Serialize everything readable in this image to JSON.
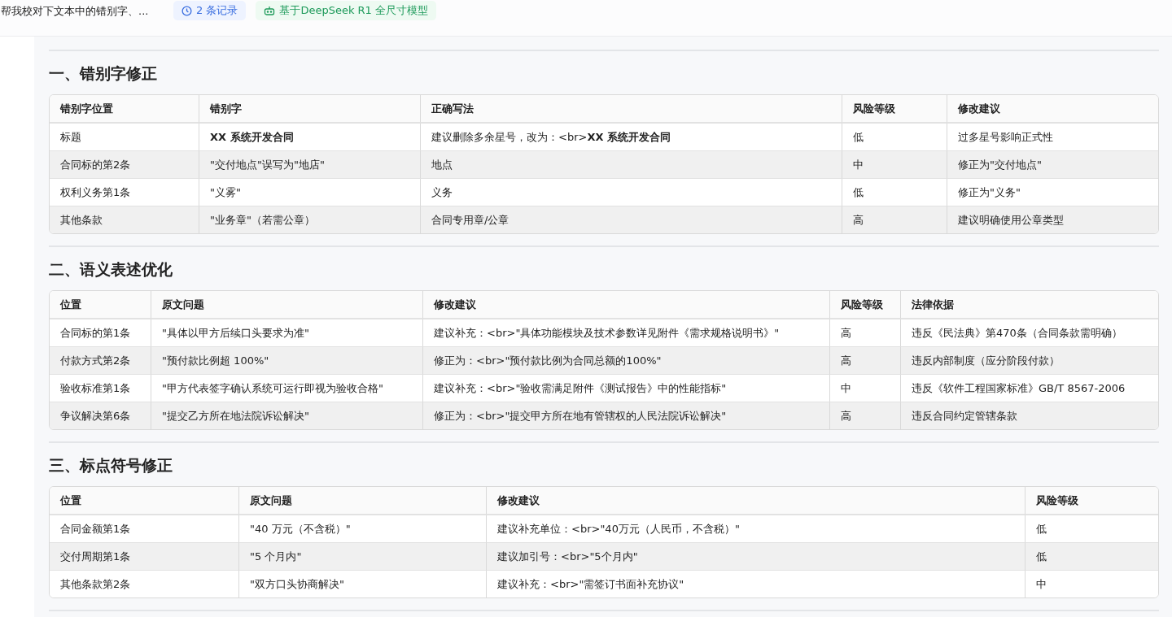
{
  "header": {
    "title": "帮我校对下文本中的错别字、...",
    "records_badge": "2 条记录",
    "model_badge": "基于DeepSeek R1 全尺寸模型"
  },
  "sections": [
    {
      "heading": "一、错别字修正",
      "columns": [
        "错别字位置",
        "错别字",
        "正确写法",
        "风险等级",
        "修改建议"
      ],
      "rows": [
        [
          "标题",
          "**XX 系统开发合同**",
          "建议删除多余星号，改为：<br>**XX 系统开发合同**",
          "低",
          "过多星号影响正式性"
        ],
        [
          "合同标的第2条",
          "\"交付地点\"误写为\"地店\"",
          "地点",
          "中",
          "修正为\"交付地点\""
        ],
        [
          "权利义务第1条",
          "\"义雾\"",
          "义务",
          "低",
          "修正为\"义务\""
        ],
        [
          "其他条款",
          "\"业务章\"（若需公章）",
          "合同专用章/公章",
          "高",
          "建议明确使用公章类型"
        ]
      ]
    },
    {
      "heading": "二、语义表述优化",
      "columns": [
        "位置",
        "原文问题",
        "修改建议",
        "风险等级",
        "法律依据"
      ],
      "rows": [
        [
          "合同标的第1条",
          "\"具体以甲方后续口头要求为准\"",
          "建议补充：<br>\"具体功能模块及技术参数详见附件《需求规格说明书》\"",
          "高",
          "违反《民法典》第470条（合同条款需明确）"
        ],
        [
          "付款方式第2条",
          "\"预付款比例超 100%\"",
          "修正为：<br>\"预付款比例为合同总额的100%\"",
          "高",
          "违反内部制度（应分阶段付款）"
        ],
        [
          "验收标准第1条",
          "\"甲方代表签字确认系统可运行即视为验收合格\"",
          "建议补充：<br>\"验收需满足附件《测试报告》中的性能指标\"",
          "中",
          "违反《软件工程国家标准》GB/T 8567-2006"
        ],
        [
          "争议解决第6条",
          "\"提交乙方所在地法院诉讼解决\"",
          "修正为：<br>\"提交甲方所在地有管辖权的人民法院诉讼解决\"",
          "高",
          "违反合同约定管辖条款"
        ]
      ]
    },
    {
      "heading": "三、标点符号修正",
      "columns": [
        "位置",
        "原文问题",
        "修改建议",
        "风险等级"
      ],
      "rows": [
        [
          "合同金额第1条",
          "\"40 万元（不含税）\"",
          "建议补充单位：<br>\"40万元（人民币，不含税）\"",
          "低"
        ],
        [
          "交付周期第1条",
          "\"5 个月内\"",
          "建议加引号：<br>\"5个月内\"",
          "低"
        ],
        [
          "其他条款第2条",
          "\"双方口头协商解决\"",
          "建议补充：<br>\"需签订书面补充协议\"",
          "中"
        ]
      ]
    }
  ]
}
